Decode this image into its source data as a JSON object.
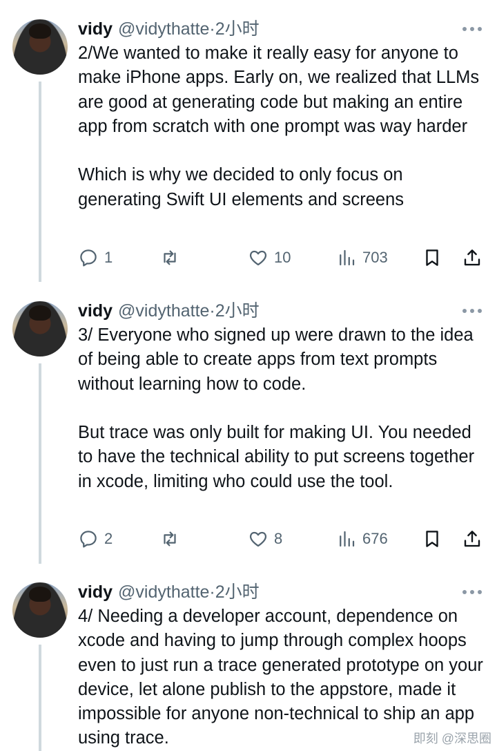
{
  "tweets": [
    {
      "name": "vidy",
      "handle": "@vidythatte",
      "separator": "·",
      "time": "2小时",
      "paragraphs": [
        "2/We wanted to make it really easy for anyone to make iPhone apps. Early on, we realized that LLMs are good at generating code but making an entire app from scratch with one prompt was way harder",
        "Which is why we decided to only focus on generating Swift UI elements and screens"
      ],
      "replies": "1",
      "retweets": "",
      "likes": "10",
      "views": "703"
    },
    {
      "name": "vidy",
      "handle": "@vidythatte",
      "separator": "·",
      "time": "2小时",
      "paragraphs": [
        "3/ Everyone who signed up were drawn to the idea of being able to create apps from text prompts without learning how to code.",
        "But trace was only built for making UI. You needed to have the technical ability to put screens together in xcode, limiting who could use the tool."
      ],
      "replies": "2",
      "retweets": "",
      "likes": "8",
      "views": "676"
    },
    {
      "name": "vidy",
      "handle": "@vidythatte",
      "separator": "·",
      "time": "2小时",
      "paragraphs": [
        "4/ Needing a developer account, dependence on xcode and having to jump through complex hoops even to just run a trace generated prototype on your device, let alone publish to the appstore, made it impossible for anyone non-technical to ship an app using trace."
      ]
    }
  ],
  "watermark": "即刻 @深思圈",
  "icons": {
    "reply": "reply-icon",
    "retweet": "retweet-icon",
    "like": "heart-icon",
    "views": "views-icon",
    "bookmark": "bookmark-icon",
    "share": "share-icon",
    "more": "more-icon"
  },
  "colors": {
    "text": "#0f1419",
    "secondary": "#536471",
    "thread_line": "#cfd9de"
  }
}
